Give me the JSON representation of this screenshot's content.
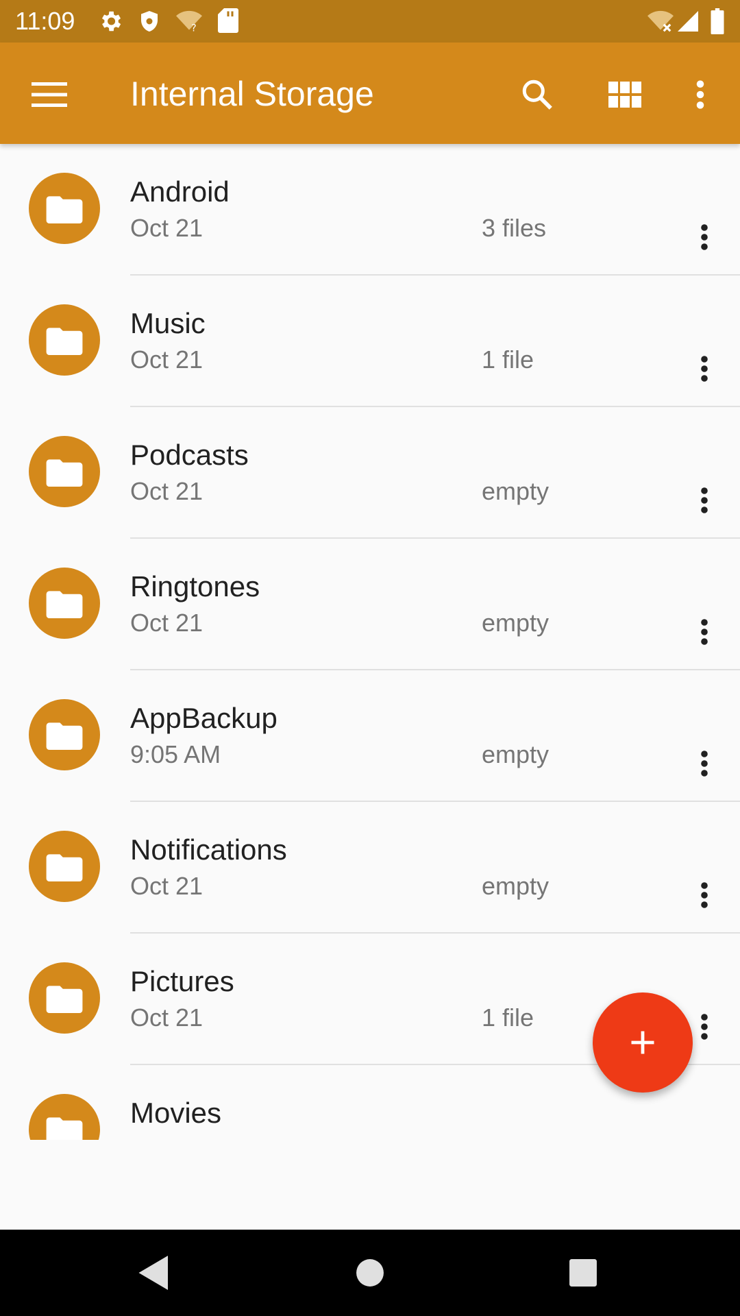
{
  "status_bar": {
    "time": "11:09",
    "left_icons": [
      "settings-icon",
      "shield-icon",
      "wifi-question-icon",
      "sd-card-icon"
    ],
    "right_icons": [
      "wifi-off-icon",
      "signal-icon",
      "battery-icon"
    ]
  },
  "app_bar": {
    "title": "Internal Storage",
    "menu_icon": "hamburger-menu-icon",
    "actions": [
      "search-icon",
      "grid-view-icon",
      "more-vert-icon"
    ]
  },
  "colors": {
    "accent": "#d4891b",
    "status_bar": "#b57a17",
    "fab": "#ee3a16",
    "background": "#fafafa"
  },
  "folders": [
    {
      "name": "Android",
      "date": "Oct 21",
      "count": "3 files"
    },
    {
      "name": "Music",
      "date": "Oct 21",
      "count": "1 file"
    },
    {
      "name": "Podcasts",
      "date": "Oct 21",
      "count": "empty"
    },
    {
      "name": "Ringtones",
      "date": "Oct 21",
      "count": "empty"
    },
    {
      "name": "AppBackup",
      "date": "9:05 AM",
      "count": "empty"
    },
    {
      "name": "Notifications",
      "date": "Oct 21",
      "count": "empty"
    },
    {
      "name": "Pictures",
      "date": "Oct 21",
      "count": "1 file"
    },
    {
      "name": "Movies",
      "date": "",
      "count": ""
    }
  ],
  "fab": {
    "icon": "plus-icon"
  },
  "nav_bar": [
    "back-icon",
    "home-icon",
    "recents-icon"
  ]
}
